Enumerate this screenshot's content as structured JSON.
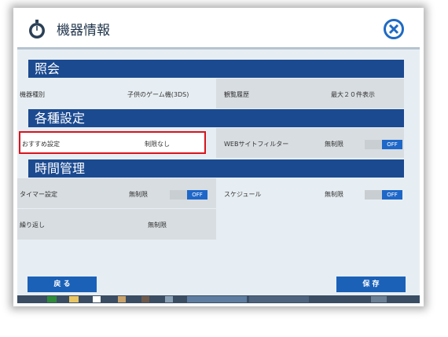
{
  "window": {
    "title": "機器情報"
  },
  "sections": {
    "inquiry": "照会",
    "settings": "各種設定",
    "time": "時間管理"
  },
  "inquiry": {
    "device_type_label": "機器種別",
    "device_type_value": "子供のゲーム機(3DS)",
    "browse_history_label": "観覧履歴",
    "browse_history_value": "最大２０件表示"
  },
  "settings": {
    "recommend_label": "おすすめ設定",
    "recommend_value": "制限なし",
    "web_filter_label": "WEBサイトフィルター",
    "web_filter_value": "無制限",
    "web_filter_toggle": "OFF"
  },
  "time": {
    "timer_label": "タイマー設定",
    "timer_value": "無制限",
    "timer_toggle": "OFF",
    "schedule_label": "スケジュール",
    "schedule_value": "無制限",
    "schedule_toggle": "OFF",
    "repeat_label": "繰り返し",
    "repeat_value": "無制限"
  },
  "buttons": {
    "back": "戻 る",
    "save": "保 存"
  },
  "colors": {
    "section_header": "#1b4a90",
    "toggle_on": "#1e67c8",
    "highlight": "#d8141c",
    "button": "#1b61b8"
  }
}
